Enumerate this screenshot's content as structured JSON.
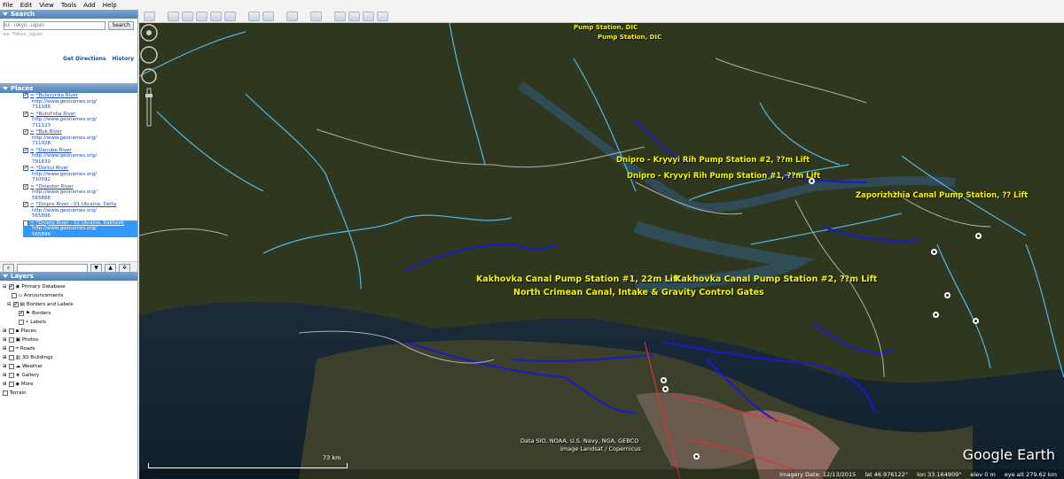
{
  "menu": [
    "File",
    "Edit",
    "View",
    "Tools",
    "Add",
    "Help"
  ],
  "search": {
    "header": "Search",
    "placeholder": "ex: Tokyo, Japan",
    "button": "Search",
    "get_directions": "Get Directions",
    "history": "History"
  },
  "places": {
    "header": "Places",
    "items": [
      {
        "title": "*Bulavynka River",
        "url": "http://www.geonames.org/",
        "id": "711188"
      },
      {
        "title": "*Buruf'sha River",
        "url": "http://www.geonames.org/",
        "id": "711123"
      },
      {
        "title": "*Buk River",
        "url": "http://www.geonames.org/",
        "id": "711028"
      },
      {
        "title": "*Danube River",
        "url": "http://www.geonames.org/",
        "id": "791630"
      },
      {
        "title": "*Derkul River",
        "url": "http://www.geonames.org/",
        "id": "710092"
      },
      {
        "title": "*Dniester River",
        "url": "http://www.geonames.org/",
        "id": "565888"
      },
      {
        "title": "*Dnipro River - 01 Ukraine, Delta",
        "url": "http://www.geonames.org/",
        "id": "565896"
      },
      {
        "title": "*Dnipro River - 02 Ukraine, Kakhovk",
        "url": "http://www.geonames.org/",
        "id": "565896"
      }
    ]
  },
  "layers": {
    "header": "Layers",
    "items": [
      {
        "label": "Primary Database",
        "checked": true
      },
      {
        "label": "Announcements",
        "checked": false
      },
      {
        "label": "Borders and Labels",
        "checked": true
      },
      {
        "label": "Borders",
        "checked": true
      },
      {
        "label": "Labels",
        "checked": false
      },
      {
        "label": "Places",
        "checked": false
      },
      {
        "label": "Photos",
        "checked": false
      },
      {
        "label": "Roads",
        "checked": false
      },
      {
        "label": "3D Buildings",
        "checked": false
      },
      {
        "label": "Weather",
        "checked": false
      },
      {
        "label": "Gallery",
        "checked": false
      },
      {
        "label": "More",
        "checked": false
      },
      {
        "label": "Terrain",
        "checked": false
      }
    ]
  },
  "map": {
    "labels": {
      "pump_dic_1": "Pump Station, DIC",
      "pump_dic_2": "Pump Station, DIC",
      "kryvyi_2": "Dnipro - Kryvyi Rih Pump Station #2, ??m Lift",
      "kryvyi_1": "Dnipro - Kryvyi Rih Pump Station #1, ??m Lift",
      "zaporizhzhia": "Zaporizhzhia Canal Pump Station, ?? Lift",
      "kakhovka_1": "Kakhovka Canal Pump Station #1, 22m Lift",
      "kakhovka_2": "Kakhovka Canal Pump Station #2, ??m Lift",
      "north_crimean": "North Crimean Canal, Intake & Gravity Control Gates"
    },
    "attribution_1": "Data SIO, NOAA, U.S. Navy, NGA, GEBCO",
    "attribution_2": "Image Landsat / Copernicus",
    "brand": "Google Earth",
    "scale": "73 km"
  },
  "status": {
    "imagery_date": "Imagery Date: 12/13/2015",
    "lat": "lat   46.976122°",
    "lon": "lon   33.164909°",
    "elev": "elev   0 m",
    "eye_alt": "eye alt 279.62 km"
  },
  "colors": {
    "river_light": "#4fb8e8",
    "canal_dark": "#1a1acc",
    "border": "#b0b0b0",
    "label": "#f5f500"
  }
}
